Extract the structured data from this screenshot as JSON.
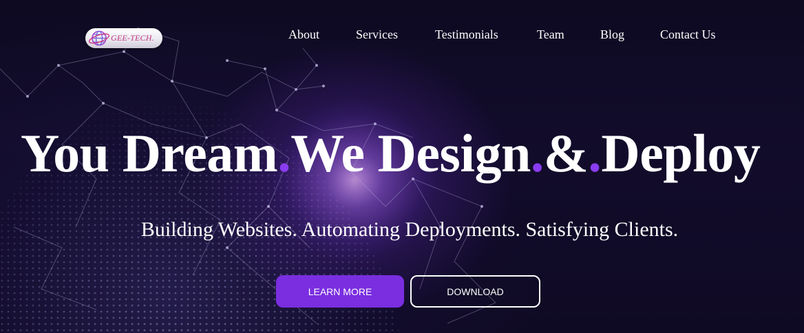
{
  "brand": {
    "logo_text": "GEE-TECH."
  },
  "nav": {
    "items": [
      {
        "label": "About"
      },
      {
        "label": "Services"
      },
      {
        "label": "Testimonials"
      },
      {
        "label": "Team"
      },
      {
        "label": "Blog"
      },
      {
        "label": "Contact Us"
      }
    ]
  },
  "hero": {
    "headline_parts": [
      "You Dream",
      ".",
      "We Design",
      ".",
      "&",
      ".",
      "Deploy"
    ],
    "subtitle": "Building Websites. Automating Deployments. Satisfying Clients.",
    "primary_button": "LEARN MORE",
    "secondary_button": "DOWNLOAD"
  },
  "colors": {
    "accent": "#8a3cf0",
    "button_primary": "#7a2ee0",
    "background": "#0d0920",
    "logo_text": "#c0357f"
  },
  "icons": {
    "logo_globe": "globe-icon",
    "background": "network-globe-graphic"
  }
}
